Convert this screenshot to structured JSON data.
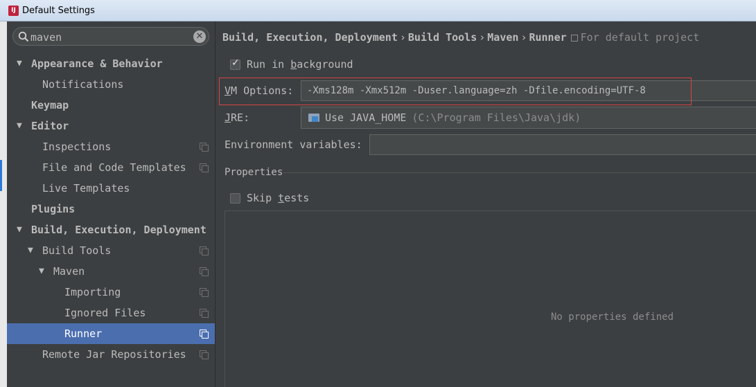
{
  "window": {
    "title": "Default Settings",
    "icon": "intellij-icon"
  },
  "search": {
    "value": "maven"
  },
  "tree": [
    {
      "label": "Appearance & Behavior",
      "bold": true,
      "arrow": "▼",
      "indent": 0,
      "copy": false,
      "selected": false,
      "name": "tree-item-appearance-behavior"
    },
    {
      "label": "Notifications",
      "bold": false,
      "arrow": "",
      "indent": 1,
      "copy": false,
      "selected": false,
      "name": "tree-item-notifications"
    },
    {
      "label": "Keymap",
      "bold": true,
      "arrow": "",
      "indent": 0,
      "copy": false,
      "selected": false,
      "name": "tree-item-keymap"
    },
    {
      "label": "Editor",
      "bold": true,
      "arrow": "▼",
      "indent": 0,
      "copy": false,
      "selected": false,
      "name": "tree-item-editor"
    },
    {
      "label": "Inspections",
      "bold": false,
      "arrow": "",
      "indent": 1,
      "copy": true,
      "selected": false,
      "name": "tree-item-inspections"
    },
    {
      "label": "File and Code Templates",
      "bold": false,
      "arrow": "",
      "indent": 1,
      "copy": true,
      "selected": false,
      "name": "tree-item-file-code-templates"
    },
    {
      "label": "Live Templates",
      "bold": false,
      "arrow": "",
      "indent": 1,
      "copy": false,
      "selected": false,
      "name": "tree-item-live-templates"
    },
    {
      "label": "Plugins",
      "bold": true,
      "arrow": "",
      "indent": 0,
      "copy": false,
      "selected": false,
      "name": "tree-item-plugins"
    },
    {
      "label": "Build, Execution, Deployment",
      "bold": true,
      "arrow": "▼",
      "indent": 0,
      "copy": false,
      "selected": false,
      "name": "tree-item-build-execution-deployment"
    },
    {
      "label": "Build Tools",
      "bold": false,
      "arrow": "▼",
      "indent": 1,
      "copy": true,
      "selected": false,
      "name": "tree-item-build-tools"
    },
    {
      "label": "Maven",
      "bold": false,
      "arrow": "▼",
      "indent": 2,
      "copy": true,
      "selected": false,
      "name": "tree-item-maven"
    },
    {
      "label": "Importing",
      "bold": false,
      "arrow": "",
      "indent": 3,
      "copy": true,
      "selected": false,
      "name": "tree-item-importing"
    },
    {
      "label": "Ignored Files",
      "bold": false,
      "arrow": "",
      "indent": 3,
      "copy": true,
      "selected": false,
      "name": "tree-item-ignored-files"
    },
    {
      "label": "Runner",
      "bold": false,
      "arrow": "",
      "indent": 3,
      "copy": true,
      "selected": true,
      "name": "tree-item-runner"
    },
    {
      "label": "Remote Jar Repositories",
      "bold": false,
      "arrow": "",
      "indent": 1,
      "copy": true,
      "selected": false,
      "name": "tree-item-remote-jar-repositories"
    }
  ],
  "breadcrumb": {
    "items": [
      "Build, Execution, Deployment",
      "Build Tools",
      "Maven",
      "Runner"
    ],
    "separator": "›",
    "note": "For default project"
  },
  "runner": {
    "run_in_background": {
      "pre": "Run in ",
      "mnemonic": "b",
      "post": "ackground",
      "checked": true
    },
    "vm_options": {
      "mnemonic": "V",
      "label_rest": "M Options:",
      "value": "-Xms128m -Xmx512m -Duser.language=zh -Dfile.encoding=UTF-8"
    },
    "jre": {
      "mnemonic": "J",
      "label_rest": "RE:",
      "value": "Use JAVA_HOME",
      "path": "(C:\\Program Files\\Java\\jdk)"
    },
    "env_vars": {
      "label": "Environment variables:",
      "value": ""
    },
    "properties": {
      "label": "Properties",
      "empty_text": "No properties defined"
    },
    "skip_tests": {
      "pre": "Skip ",
      "mnemonic": "t",
      "post": "ests",
      "checked": false
    }
  },
  "colors": {
    "background": "#3c3f41",
    "selection": "#4b6eaf",
    "highlight_border": "#d64545"
  }
}
